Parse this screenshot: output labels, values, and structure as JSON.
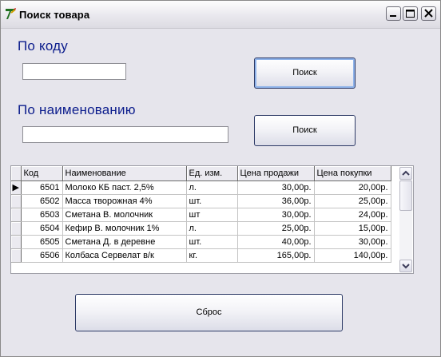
{
  "window": {
    "title": "Поиск товара"
  },
  "by_code": {
    "label": "По коду",
    "input_value": "",
    "button_label": "Поиск"
  },
  "by_name": {
    "label": "По наименованию",
    "input_value": "",
    "button_label": "Поиск"
  },
  "grid": {
    "columns": [
      "Код",
      "Наименование",
      "Ед. изм.",
      "Цена продажи",
      "Цена покупки"
    ],
    "rows": [
      [
        "6501",
        "Молоко КБ паст. 2,5%",
        "л.",
        "30,00р.",
        "20,00р."
      ],
      [
        "6502",
        "Масса творожная 4%",
        "шт.",
        "36,00р.",
        "25,00р."
      ],
      [
        "6503",
        "Сметана В. молочник",
        "шт",
        "30,00р.",
        "24,00р."
      ],
      [
        "6504",
        "Кефир В. молочник 1%",
        "л.",
        "25,00р.",
        "15,00р."
      ],
      [
        "6505",
        "Сметана Д. в деревне",
        "шт.",
        "40,00р.",
        "30,00р."
      ],
      [
        "6506",
        "Колбаса Сервелат в/к",
        "кг.",
        "165,00р.",
        "140,00р."
      ]
    ],
    "current_row_indicator": "▶"
  },
  "reset": {
    "label": "Сброс"
  }
}
